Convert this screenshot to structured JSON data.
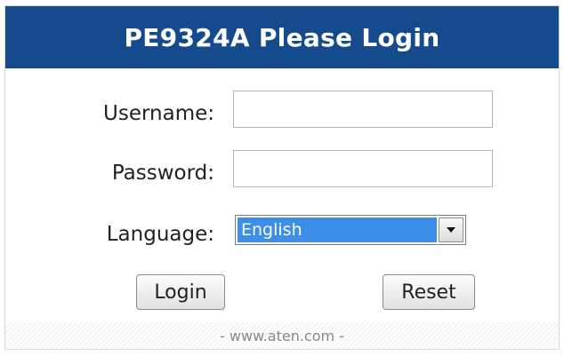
{
  "header": {
    "title": "PE9324A Please Login"
  },
  "form": {
    "username_label": "Username:",
    "username_value": "",
    "password_label": "Password:",
    "password_value": "",
    "language_label": "Language:",
    "language_selected": "English"
  },
  "buttons": {
    "login_label": "Login",
    "reset_label": "Reset"
  },
  "footer": {
    "text": "- www.aten.com -"
  },
  "colors": {
    "header_bg": "#154a8d",
    "header_text": "#ffffff",
    "select_highlight": "#3d8ee8"
  },
  "icons": {
    "select_arrow": "chevron-down-icon"
  }
}
